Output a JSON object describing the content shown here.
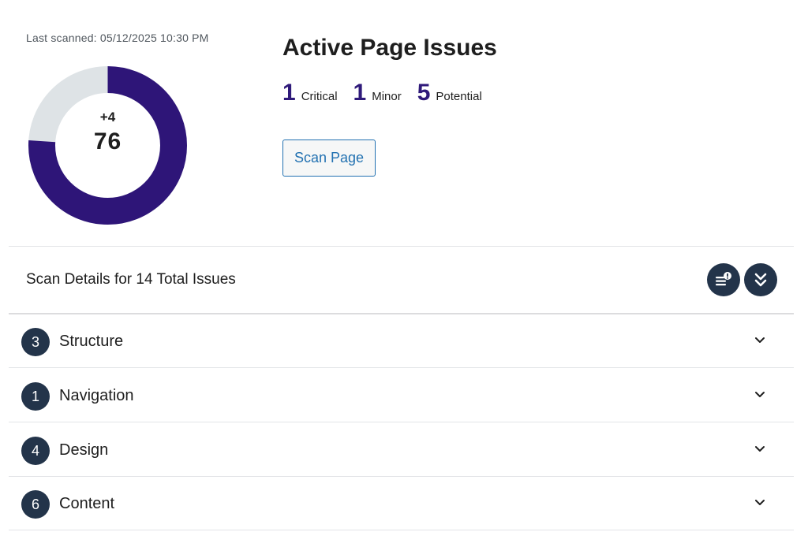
{
  "scan": {
    "last_scanned": "Last scanned: 05/12/2025 10:30 PM"
  },
  "score": {
    "delta": "+4",
    "value": "76",
    "percent": 76,
    "fill_color": "#2e1578",
    "track_color": "#dee3e6"
  },
  "summary": {
    "title": "Active Page Issues",
    "counts": [
      {
        "number": "1",
        "label": "Critical"
      },
      {
        "number": "1",
        "label": "Minor"
      },
      {
        "number": "5",
        "label": "Potential"
      }
    ],
    "scan_button_label": "Scan Page"
  },
  "details": {
    "title": "Scan Details for 14 Total Issues",
    "icons": [
      "issues-list-icon",
      "expand-all-icon"
    ]
  },
  "categories": [
    {
      "count": "3",
      "label": "Structure",
      "icon": "chevron-down-icon"
    },
    {
      "count": "1",
      "label": "Navigation",
      "icon": "chevron-down-icon"
    },
    {
      "count": "4",
      "label": "Design",
      "icon": "chevron-down-icon"
    },
    {
      "count": "6",
      "label": "Content",
      "icon": "chevron-down-icon"
    }
  ],
  "colors": {
    "accent": "#2f1a7a",
    "button_blue": "#2271b1",
    "dark_badge": "#23344a"
  }
}
